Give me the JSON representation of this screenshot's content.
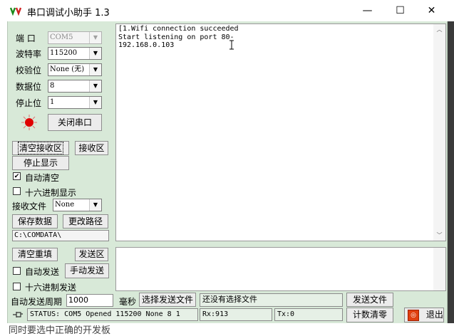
{
  "window": {
    "title": "串口调试小助手 1.3",
    "icon": "app-logo-icon",
    "minimize_glyph": "—",
    "maximize_glyph": "☐",
    "close_glyph": "✕"
  },
  "settings": {
    "port_label": "端  口",
    "port_value": "COM5",
    "baud_label": "波特率",
    "baud_value": "115200",
    "parity_label": "校验位",
    "parity_value": "None (无)",
    "databits_label": "数据位",
    "databits_value": "8",
    "stopbits_label": "停止位",
    "stopbits_value": "1",
    "led_color": "#e00000",
    "toggle_port_label": "关闭串口"
  },
  "receive": {
    "clear_label": "清空接收区",
    "area_label": "接收区",
    "stop_display_label": "停止显示",
    "auto_clear_label": "自动清空",
    "auto_clear_checked": true,
    "hex_display_label": "十六进制显示",
    "hex_display_checked": false,
    "file_label": "接收文件",
    "file_type_value": "None",
    "save_label": "保存数据",
    "change_path_label": "更改路径",
    "path_value": "C:\\COMDATA\\",
    "lines": [
      "[1.Wifi connection succeeded",
      "Start listening on port 80-",
      "192.168.0.103"
    ]
  },
  "send": {
    "clear_resend_label": "清空重填",
    "area_label": "发送区",
    "auto_send_label": "自动发送",
    "auto_send_checked": false,
    "manual_send_label": "手动发送",
    "hex_send_label": "十六进制发送",
    "hex_send_checked": false,
    "period_label": "自动发送周期",
    "period_value": "1000",
    "period_unit": "毫秒",
    "select_file_label": "选择发送文件",
    "no_file_text": "还没有选择文件",
    "send_file_label": "发送文件"
  },
  "status": {
    "pin_icon": "pin-icon",
    "status_text": "STATUS: COM5 Opened 115200 None  8 1",
    "rx_text": "Rx:913",
    "tx_text": "Tx:0",
    "reset_count_label": "计数清零",
    "exit_label": "退出"
  },
  "background": {
    "partial_text": "同时要选中正确的开发板"
  }
}
